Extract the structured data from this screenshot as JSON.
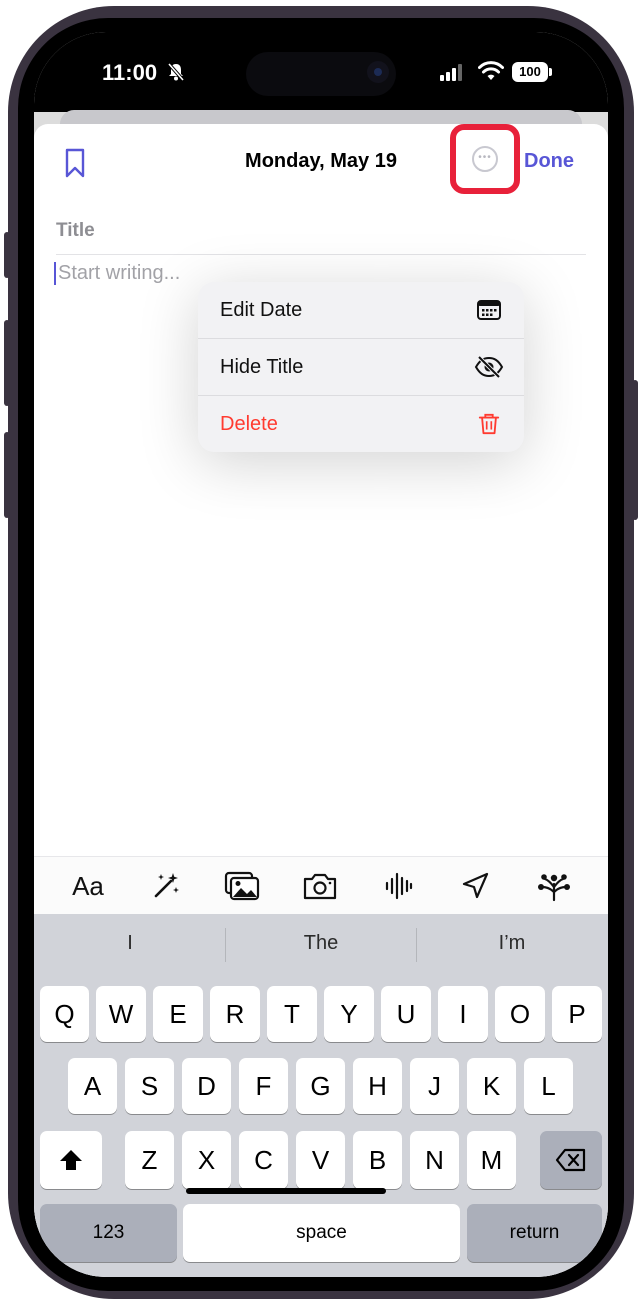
{
  "status": {
    "time": "11:00",
    "battery": "100"
  },
  "nav": {
    "title": "Monday, May 19",
    "done_label": "Done"
  },
  "editor": {
    "title_placeholder": "Title",
    "body_placeholder": "Start writing..."
  },
  "menu": {
    "items": [
      {
        "label": "Edit Date",
        "icon": "calendar-icon"
      },
      {
        "label": "Hide Title",
        "icon": "eye-slash-icon"
      },
      {
        "label": "Delete",
        "icon": "trash-icon",
        "destructive": true
      }
    ]
  },
  "toolbar": {
    "text_format_label": "Aa"
  },
  "keyboard": {
    "suggestions": [
      "I",
      "The",
      "I’m"
    ],
    "rows": [
      [
        "Q",
        "W",
        "E",
        "R",
        "T",
        "Y",
        "U",
        "I",
        "O",
        "P"
      ],
      [
        "A",
        "S",
        "D",
        "F",
        "G",
        "H",
        "J",
        "K",
        "L"
      ],
      [
        "Z",
        "X",
        "C",
        "V",
        "B",
        "N",
        "M"
      ]
    ],
    "numbers_label": "123",
    "space_label": "space",
    "return_label": "return"
  },
  "colors": {
    "accent": "#5856d6",
    "highlight": "#e8213a",
    "destructive": "#ff3b30"
  }
}
